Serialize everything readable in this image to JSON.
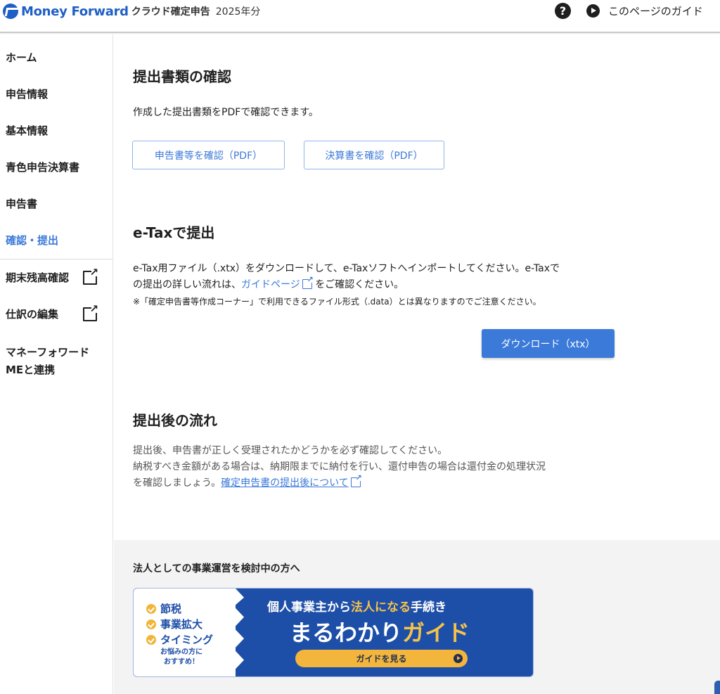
{
  "header": {
    "brand": "Money Forward",
    "app_name": "クラウド確定申告",
    "year": "2025年分",
    "help_icon": "?",
    "guide_label": "このページのガイド"
  },
  "sidebar": {
    "items": [
      {
        "label": "ホーム"
      },
      {
        "label": "申告情報"
      },
      {
        "label": "基本情報"
      },
      {
        "label": "青色申告決算書"
      },
      {
        "label": "申告書"
      },
      {
        "label": "確認・提出",
        "active": true
      },
      {
        "label": "期末残高確認",
        "external": true
      },
      {
        "label": "仕訳の編集",
        "external": true
      }
    ],
    "multiline_item": {
      "line1": "マネーフォワード",
      "line2": "MEと連携"
    }
  },
  "documents": {
    "title": "提出書類の確認",
    "description": "作成した提出書類をPDFで確認できます。",
    "btn_declaration": "申告書等を確認（PDF）",
    "btn_financial": "決算書を確認（PDF）"
  },
  "etax": {
    "title": "e-Taxで提出",
    "text_line1": "e-Tax用ファイル（.xtx）をダウンロードして、e-Taxソフトへインポートしてください。e-Taxで",
    "text_line2_prefix": "の提出の詳しい流れは、",
    "guide_link": "ガイドページ",
    "text_line2_suffix": "をご確認ください。",
    "note": "※「確定申告書等作成コーナー」で利用できるファイル形式（.data）とは異なりますのでご注意ください。",
    "download_button": "ダウンロード（xtx）"
  },
  "after": {
    "title": "提出後の流れ",
    "line1": "提出後、申告書が正しく受理されたかどうかを必ず確認してください。",
    "line2": "納税すべき金額がある場合は、納期限までに納付を行い、還付申告の場合は還付金の処理状況",
    "line3_prefix": "を確認しましょう。",
    "link": "確定申告書の提出後について"
  },
  "promo": {
    "title": "法人としての事業運営を検討中の方へ",
    "checks": [
      "節税",
      "事業拡大",
      "タイミング"
    ],
    "small_line1": "お悩みの方に",
    "small_line2": "おすすめ！",
    "sub_part1": "個人事業主から",
    "sub_hl": "法人になる",
    "sub_part2": "手続き",
    "main_part1": "まるわかり",
    "main_hl": "ガイド",
    "button": "ガイドを見る"
  },
  "colors": {
    "accent": "#3b7ad9",
    "brand": "#1f5fc5",
    "banner_blue": "#1e4fa8",
    "banner_yellow": "#f3b53b"
  }
}
